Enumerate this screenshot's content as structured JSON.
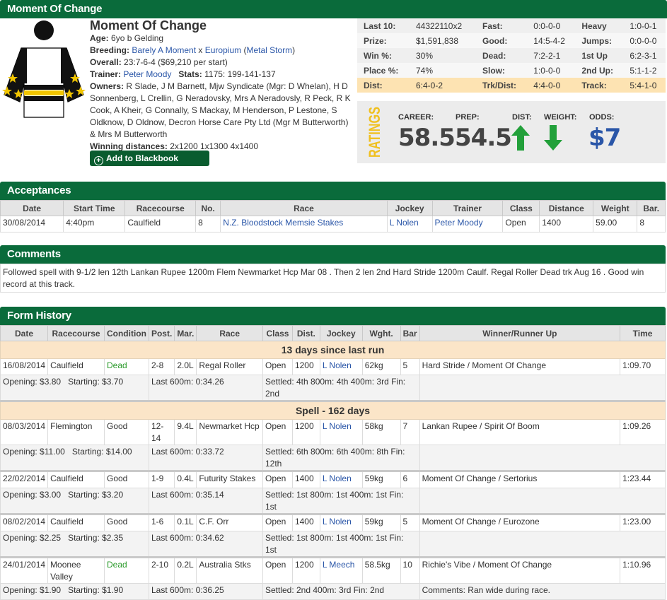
{
  "header": {
    "title": "Moment Of Change",
    "horse_name": "Moment Of Change",
    "age_label": "Age:",
    "age": "6yo b Gelding",
    "breeding_label": "Breeding:",
    "sire": "Barely A Moment",
    "breeding_x": " x ",
    "dam": "Europium",
    "damsire": "Metal Storm",
    "overall_label": "Overall:",
    "overall": "23:7-6-4 ($69,210 per start)",
    "trainer_label": "Trainer:",
    "trainer": "Peter Moody",
    "stats_label": "Stats:",
    "stats": "1175: 199-141-137",
    "owners_label": "Owners:",
    "owners": "R Slade, J M Barnett, Mjw Syndicate (Mgr: D Whelan), H D Sonnenberg, L Crellin, G Neradovsky, Mrs A Neradovsly, R Peck, R K Cook, A Kheir, G Connally, S Mackay, M Henderson, P Lestone, S Oldknow, D Oldnow, Decron Horse Care Pty Ltd (Mgr M Butterworth) & Mrs M Butterworth",
    "winning_label": "Winning distances:",
    "winning": "2x1200 1x1300 4x1400",
    "blackbook_button": "Add to Blackbook"
  },
  "stats": [
    [
      [
        "Last 10:",
        "44322110x2"
      ],
      [
        "Fast:",
        "0:0-0-0"
      ],
      [
        "Heavy",
        "1:0-0-1"
      ]
    ],
    [
      [
        "Prize:",
        "$1,591,838"
      ],
      [
        "Good:",
        "14:5-4-2"
      ],
      [
        "Jumps:",
        "0:0-0-0"
      ]
    ],
    [
      [
        "Win %:",
        "30%"
      ],
      [
        "Dead:",
        "7:2-2-1"
      ],
      [
        "1st Up",
        "6:2-3-1"
      ]
    ],
    [
      [
        "Place %:",
        "74%"
      ],
      [
        "Slow:",
        "1:0-0-0"
      ],
      [
        "2nd Up:",
        "5:1-1-2"
      ]
    ],
    [
      [
        "Dist:",
        "6:4-0-2"
      ],
      [
        "Trk/Dist:",
        "4:4-0-0"
      ],
      [
        "Track:",
        "5:4-1-0"
      ]
    ]
  ],
  "ratings": {
    "title": "RATINGS",
    "career_label": "CAREER:",
    "career": "58.5",
    "prep_label": "PREP:",
    "prep": "54.5",
    "dist_label": "DIST:",
    "dist_direction": "up",
    "weight_label": "WEIGHT:",
    "weight_direction": "down",
    "odds_label": "ODDS:",
    "odds": "$7",
    "colors": {
      "arrow": "#22a03a",
      "odds": "#2a56a8",
      "title": "#f0c020"
    }
  },
  "acceptances": {
    "title": "Acceptances",
    "columns": [
      "Date",
      "Start Time",
      "Racecourse",
      "No.",
      "Race",
      "Jockey",
      "Trainer",
      "Class",
      "Distance",
      "Weight",
      "Bar."
    ],
    "rows": [
      [
        "30/08/2014",
        "4:40pm",
        "Caulfield",
        "8",
        "N.Z. Bloodstock Memsie Stakes",
        "L Nolen",
        "Peter Moody",
        "Open",
        "1400",
        "59.00",
        "8"
      ]
    ]
  },
  "comments": {
    "title": "Comments",
    "text": "Followed spell with 9-1/2 len 12th Lankan Rupee 1200m Flem Newmarket Hcp Mar 08 . Then 2 len 2nd Hard Stride 1200m Caulf. Regal Roller Dead trk Aug 16 . Good win record at this track."
  },
  "form": {
    "title": "Form History",
    "columns": [
      "Date",
      "Racecourse",
      "Condition",
      "Post.",
      "Mar.",
      "Race",
      "Class",
      "Dist.",
      "Jockey",
      "Wght.",
      "Bar",
      "Winner/Runner Up",
      "Time"
    ],
    "gap1": "13 days since last run",
    "gap2": "Spell - 162 days",
    "runs": [
      {
        "date": "16/08/2014",
        "course": "Caulfield",
        "cond": "Dead",
        "post": "2-8",
        "mar": "2.0L",
        "race": "Regal Roller",
        "cls": "Open",
        "dist": "1200",
        "jockey": "L Nolen",
        "wght": "62kg",
        "bar": "5",
        "winner": "Hard Stride / Moment Of Change",
        "time": "1:09.70",
        "opening": "Opening: $3.80",
        "starting": "Starting: $3.70",
        "last600": "Last 600m: 0:34.26",
        "settled": "Settled: 4th 800m: 4th 400m: 3rd Fin: 2nd",
        "comment": ""
      },
      {
        "date": "08/03/2014",
        "course": "Flemington",
        "cond": "Good",
        "post": "12-14",
        "mar": "9.4L",
        "race": "Newmarket Hcp",
        "cls": "Open",
        "dist": "1200",
        "jockey": "L Nolen",
        "wght": "58kg",
        "bar": "7",
        "winner": "Lankan Rupee / Spirit Of Boom",
        "time": "1:09.26",
        "opening": "Opening: $11.00",
        "starting": "Starting: $14.00",
        "last600": "Last 600m: 0:33.72",
        "settled": "Settled: 6th 800m: 6th 400m: 8th Fin: 12th",
        "comment": ""
      },
      {
        "date": "22/02/2014",
        "course": "Caulfield",
        "cond": "Good",
        "post": "1-9",
        "mar": "0.4L",
        "race": "Futurity Stakes",
        "cls": "Open",
        "dist": "1400",
        "jockey": "L Nolen",
        "wght": "59kg",
        "bar": "6",
        "winner": "Moment Of Change / Sertorius",
        "time": "1:23.44",
        "opening": "Opening: $3.00",
        "starting": "Starting: $3.20",
        "last600": "Last 600m: 0:35.14",
        "settled": "Settled: 1st 800m: 1st 400m: 1st Fin: 1st",
        "comment": ""
      },
      {
        "date": "08/02/2014",
        "course": "Caulfield",
        "cond": "Good",
        "post": "1-6",
        "mar": "0.1L",
        "race": "C.F. Orr",
        "cls": "Open",
        "dist": "1400",
        "jockey": "L Nolen",
        "wght": "59kg",
        "bar": "5",
        "winner": "Moment Of Change / Eurozone",
        "time": "1:23.00",
        "opening": "Opening: $2.25",
        "starting": "Starting: $2.35",
        "last600": "Last 600m: 0:34.62",
        "settled": "Settled: 1st 800m: 1st 400m: 1st Fin: 1st",
        "comment": ""
      },
      {
        "date": "24/01/2014",
        "course": "Moonee Valley",
        "cond": "Dead",
        "post": "2-10",
        "mar": "0.2L",
        "race": "Australia Stks",
        "cls": "Open",
        "dist": "1200",
        "jockey": "L Meech",
        "wght": "58.5kg",
        "bar": "10",
        "winner": "Richie's Vibe / Moment Of Change",
        "time": "1:10.96",
        "opening": "Opening: $1.90",
        "starting": "Starting: $1.90",
        "last600": "Last 600m: 0:36.25",
        "settled": "Settled: 2nd 400m: 3rd Fin: 2nd",
        "comment": "Comments: Ran wide during race."
      }
    ]
  }
}
